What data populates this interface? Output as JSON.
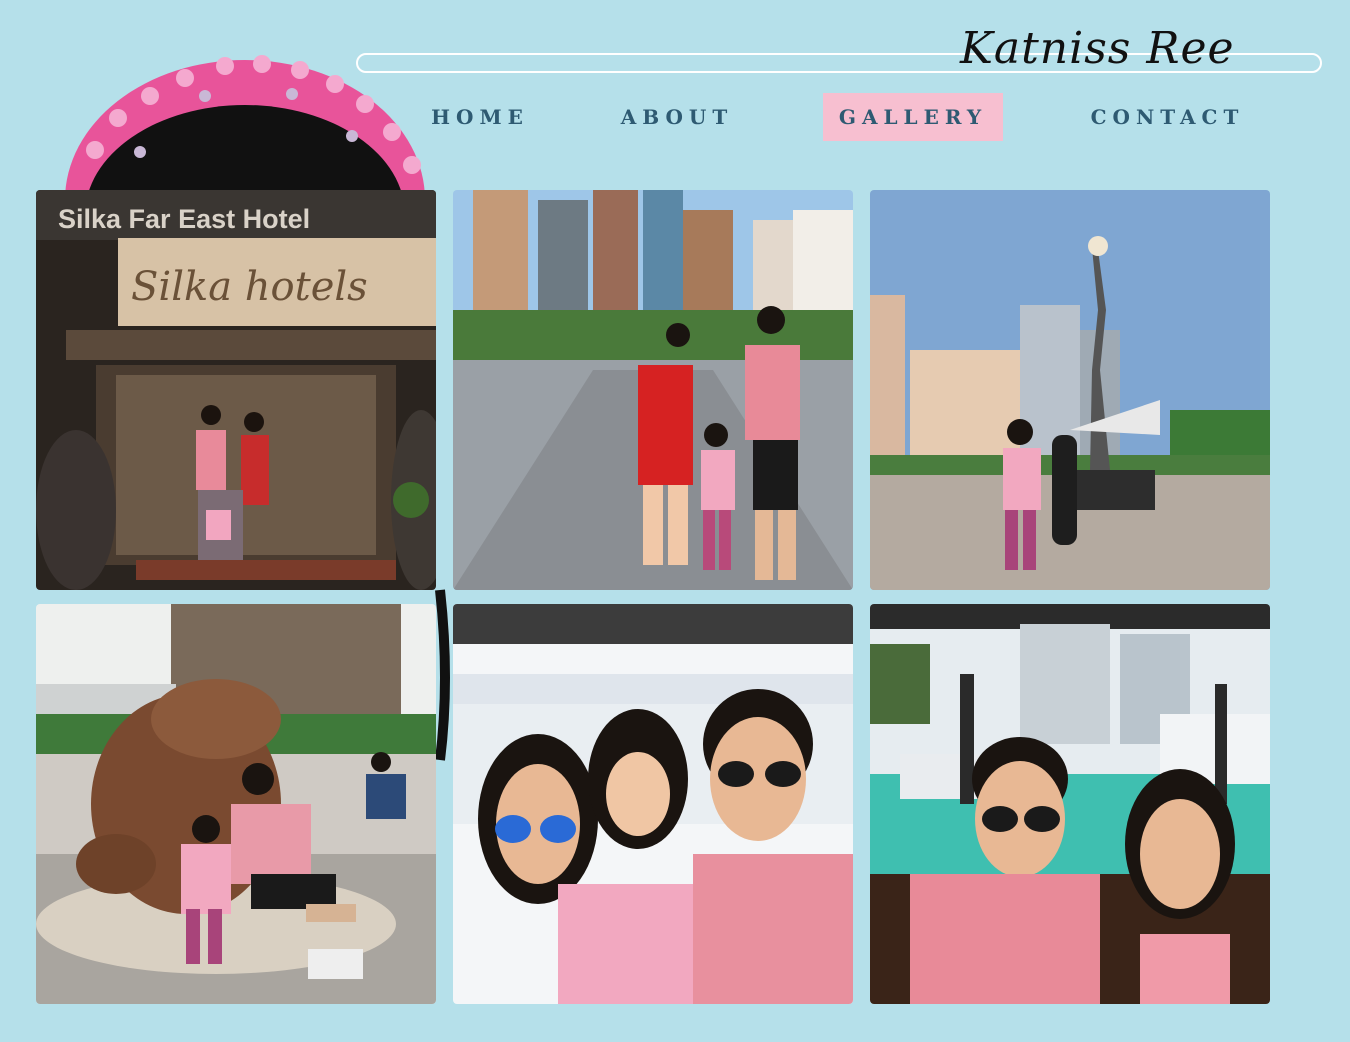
{
  "brand": {
    "name": "Katniss Ree"
  },
  "nav": {
    "items": [
      {
        "label": "HOME"
      },
      {
        "label": "ABOUT"
      },
      {
        "label": "GALLERY"
      },
      {
        "label": "CONTACT"
      }
    ],
    "active": "GALLERY"
  },
  "colors": {
    "page_background": "#b5e0ea",
    "nav_text": "#2e5a72",
    "nav_active_bg": "#f7bfd0"
  },
  "gallery": {
    "photos": [
      {
        "sign_text": "Silka Far East Hotel",
        "logo_text": "Silka hotels"
      },
      {
        "sign_text": ""
      },
      {
        "sign_text": ""
      },
      {
        "sign_text": ""
      },
      {
        "sign_text": ""
      },
      {
        "sign_text": ""
      }
    ]
  }
}
